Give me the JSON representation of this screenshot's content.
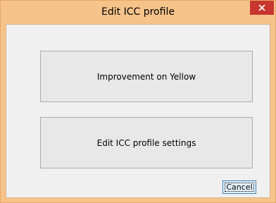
{
  "window": {
    "title": "Edit ICC profile",
    "frame_color": "#f6c38b",
    "close_color": "#c7372f"
  },
  "buttons": {
    "improvement": "Improvement on Yellow",
    "settings": "Edit ICC profile settings",
    "cancel": "Cancel"
  },
  "icons": {
    "close": "close-icon"
  }
}
